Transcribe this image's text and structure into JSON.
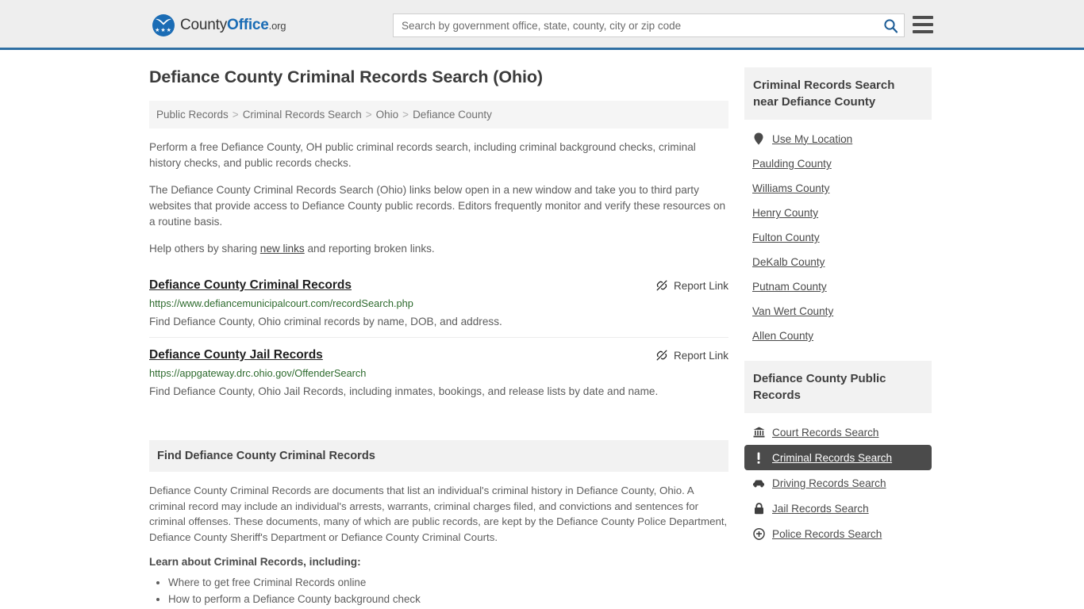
{
  "header": {
    "logo": {
      "text_county": "County",
      "text_office": "Office",
      "text_tld": ".org",
      "stars": "★★★",
      "icon": "eagle-logo-icon"
    },
    "search": {
      "placeholder": "Search by government office, state, county, city or zip code",
      "value": "",
      "button_icon": "search-icon"
    },
    "menu_icon": "hamburger-menu-icon"
  },
  "main": {
    "title": "Defiance County Criminal Records Search (Ohio)",
    "breadcrumb": {
      "separator": ">",
      "items": [
        {
          "label": "Public Records"
        },
        {
          "label": "Criminal Records Search"
        },
        {
          "label": "Ohio"
        },
        {
          "label": "Defiance County"
        }
      ]
    },
    "intro": {
      "p1": "Perform a free Defiance County, OH public criminal records search, including criminal background checks, criminal history checks, and public records checks.",
      "p2": "The Defiance County Criminal Records Search (Ohio) links below open in a new window and take you to third party websites that provide access to Defiance County public records. Editors frequently monitor and verify these resources on a routine basis.",
      "p3_pre": "Help others by sharing ",
      "p3_link": "new links",
      "p3_post": " and reporting broken links."
    },
    "results": [
      {
        "title": "Defiance County Criminal Records",
        "url": "https://www.defiancemunicipalcourt.com/recordSearch.php",
        "description": "Find Defiance County, Ohio criminal records by name, DOB, and address.",
        "report_label": "Report Link",
        "report_icon": "broken-link-icon"
      },
      {
        "title": "Defiance County Jail Records",
        "url": "https://appgateway.drc.ohio.gov/OffenderSearch",
        "description": "Find Defiance County, Ohio Jail Records, including inmates, bookings, and release lists by date and name.",
        "report_label": "Report Link",
        "report_icon": "broken-link-icon"
      }
    ],
    "section": {
      "heading": "Find Defiance County Criminal Records",
      "paragraph": "Defiance County Criminal Records are documents that list an individual's criminal history in Defiance County, Ohio. A criminal record may include an individual's arrests, warrants, criminal charges filed, and convictions and sentences for criminal offenses. These documents, many of which are public records, are kept by the Defiance County Police Department, Defiance County Sheriff's Department or Defiance County Criminal Courts.",
      "learn_heading": "Learn about Criminal Records, including:",
      "bullets": [
        "Where to get free Criminal Records online",
        "How to perform a Defiance County background check"
      ]
    }
  },
  "sidebar": {
    "nearby": {
      "heading": "Criminal Records Search near Defiance County",
      "items": [
        {
          "label": "Use My Location",
          "icon": "map-pin-icon",
          "has_icon": true
        },
        {
          "label": "Paulding County",
          "icon": "",
          "has_icon": false
        },
        {
          "label": "Williams County",
          "icon": "",
          "has_icon": false
        },
        {
          "label": "Henry County",
          "icon": "",
          "has_icon": false
        },
        {
          "label": "Fulton County",
          "icon": "",
          "has_icon": false
        },
        {
          "label": "DeKalb County",
          "icon": "",
          "has_icon": false
        },
        {
          "label": "Putnam County",
          "icon": "",
          "has_icon": false
        },
        {
          "label": "Van Wert County",
          "icon": "",
          "has_icon": false
        },
        {
          "label": "Allen County",
          "icon": "",
          "has_icon": false
        }
      ]
    },
    "public_records": {
      "heading": "Defiance County Public Records",
      "items": [
        {
          "label": "Court Records Search",
          "icon": "courthouse-icon",
          "active": false
        },
        {
          "label": "Criminal Records Search",
          "icon": "exclamation-icon",
          "active": true
        },
        {
          "label": "Driving Records Search",
          "icon": "car-icon",
          "active": false
        },
        {
          "label": "Jail Records Search",
          "icon": "lock-icon",
          "active": false
        },
        {
          "label": "Police Records Search",
          "icon": "police-badge-icon",
          "active": false
        }
      ]
    }
  },
  "colors": {
    "brand_blue": "#1a6cb5",
    "header_border": "#2f6fa3",
    "header_bg": "#eeeeee",
    "url_green": "#2e6b2e",
    "active_bg": "#4b4b4b",
    "panel_gray": "#f2f2f2"
  }
}
